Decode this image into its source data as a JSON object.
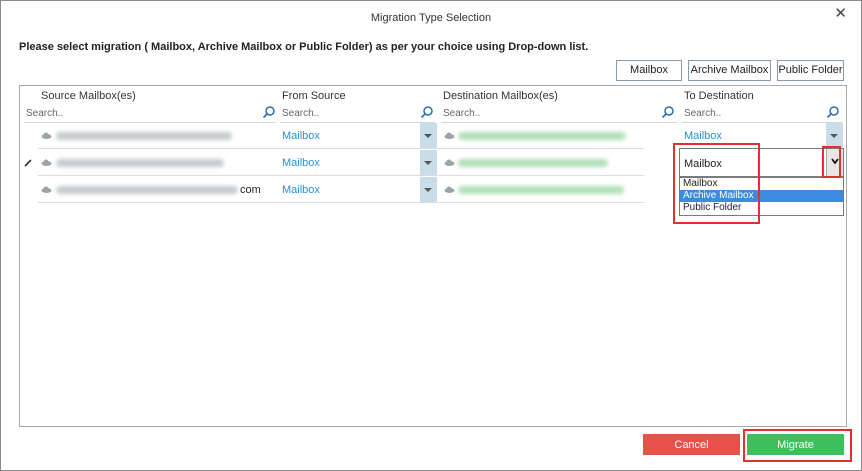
{
  "window": {
    "title": "Migration Type Selection",
    "close": "✕"
  },
  "instruction": "Please select migration ( Mailbox, Archive Mailbox or Public Folder) as per your choice using Drop-down list.",
  "toolbar": {
    "mailbox": "Mailbox",
    "archive_mailbox": "Archive Mailbox",
    "public_folder": "Public Folder"
  },
  "grid": {
    "columns": [
      {
        "label": "Source Mailbox(es)",
        "search_placeholder": "Search.."
      },
      {
        "label": "From Source",
        "search_placeholder": "Search.."
      },
      {
        "label": "Destination Mailbox(es)",
        "search_placeholder": "Search.."
      },
      {
        "label": "To Destination",
        "search_placeholder": "Search.."
      }
    ],
    "rows": [
      {
        "source_suffix": "",
        "from_source": "Mailbox",
        "to_destination": "Mailbox"
      },
      {
        "source_suffix": "",
        "from_source": "Mailbox",
        "to_destination": "Mailbox"
      },
      {
        "source_suffix": "com",
        "from_source": "Mailbox",
        "to_destination": ""
      }
    ]
  },
  "dropdown": {
    "current_value": "Mailbox",
    "options": [
      "Mailbox",
      "Archive Mailbox",
      "Public Folder"
    ],
    "highlighted": "Archive Mailbox"
  },
  "footer": {
    "cancel": "Cancel",
    "migrate": "Migrate"
  },
  "colors": {
    "link": "#2a8ed6",
    "cancel": "#e8504a",
    "migrate": "#3cc05b",
    "highlight_box": "#e03030",
    "selected_option": "#3b8be0"
  },
  "icons": [
    "close-icon",
    "search-icon",
    "cloud-icon",
    "dropdown-arrow-icon",
    "chevron-down-icon",
    "pencil-icon"
  ]
}
